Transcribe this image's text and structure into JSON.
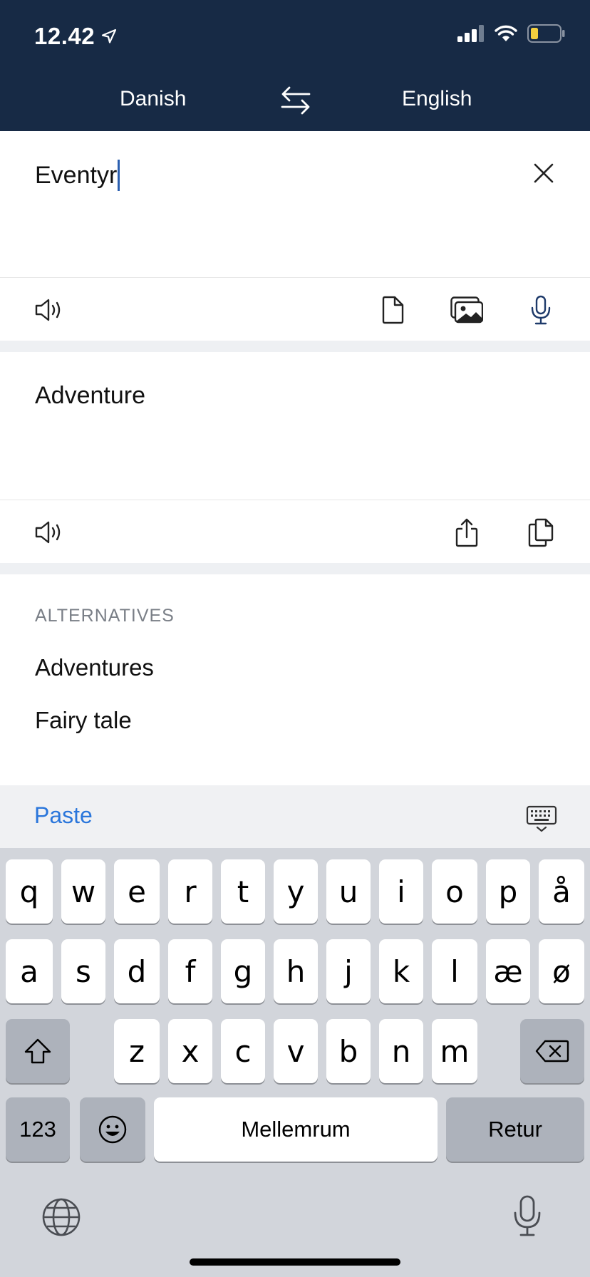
{
  "status": {
    "time": "12.42",
    "icons": [
      "location-arrow-icon",
      "signal-icon",
      "wifi-icon",
      "battery-icon"
    ]
  },
  "languages": {
    "source": "Danish",
    "target": "English",
    "swap_icon": "swap-arrows-icon"
  },
  "input": {
    "value": "Eventyr",
    "icons": [
      "clear-icon",
      "speaker-icon",
      "document-icon",
      "image-icon",
      "microphone-icon"
    ]
  },
  "output": {
    "value": "Adventure",
    "icons": [
      "speaker-icon",
      "share-icon",
      "copy-icon"
    ]
  },
  "alternatives": {
    "title": "ALTERNATIVES",
    "items": [
      "Adventures",
      "Fairy tale"
    ]
  },
  "paste_bar": {
    "paste_label": "Paste",
    "keyboard_icon": "keyboard-dismiss-icon"
  },
  "keyboard": {
    "row1": [
      "q",
      "w",
      "e",
      "r",
      "t",
      "y",
      "u",
      "i",
      "o",
      "p",
      "å"
    ],
    "row2": [
      "a",
      "s",
      "d",
      "f",
      "g",
      "h",
      "j",
      "k",
      "l",
      "æ",
      "ø"
    ],
    "row3": [
      "z",
      "x",
      "c",
      "v",
      "b",
      "n",
      "m"
    ],
    "numbers_label": "123",
    "space_label": "Mellemrum",
    "return_label": "Retur",
    "icons": [
      "shift-icon",
      "backspace-icon",
      "emoji-icon",
      "globe-icon",
      "dictation-icon"
    ]
  },
  "colors": {
    "header_bg": "#172a45",
    "accent": "#2a76db",
    "keyboard_bg": "#d2d5db"
  }
}
